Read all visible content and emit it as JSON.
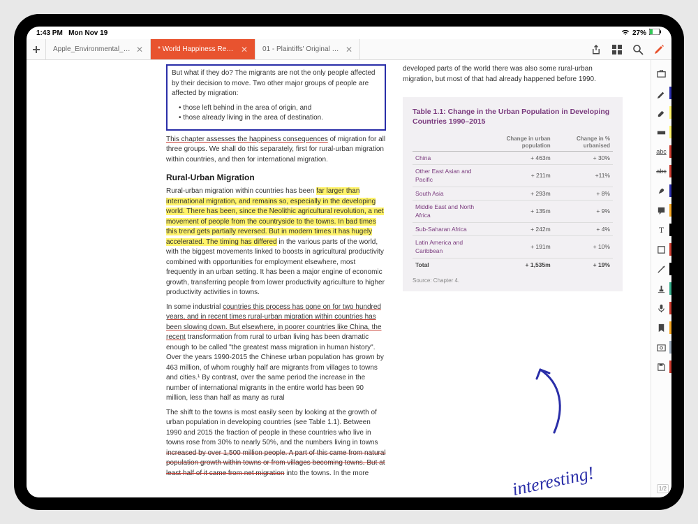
{
  "status": {
    "time": "1:43 PM",
    "date": "Mon Nov 19",
    "battery_pct": "27%"
  },
  "tabs": [
    {
      "label": "Apple_Environmental_R...",
      "active": false
    },
    {
      "label": "* World Happiness Repo...",
      "active": true
    },
    {
      "label": "01 - Plaintiffs' Original P...",
      "active": false
    }
  ],
  "doc": {
    "col1_boxed_p1": "But what if they do? The migrants are not the only people affected by their decision to move. Two other major groups of people are affected by migration:",
    "col1_boxed_b1": "those left behind in the area of origin, and",
    "col1_boxed_b2": "those already living in the area of destination.",
    "col1_p2_ul": "This chapter assesses the happiness consequences",
    "col1_p2_rest": " of migration for all three groups. We shall do this separately, first for rural-urban migration within countries, and then for international migration.",
    "col1_h": "Rural-Urban Migration",
    "col1_p3_a": "Rural-urban migration within countries has been ",
    "col1_p3_hl": "far larger than international migration, and remains so, especially in the developing world. There has been, since the Neolithic agricultural revolution, a net movement of people from the countryside to the towns. In bad times this trend gets partially reversed. But in modern times it has hugely accelerated. The timing has differed",
    "col1_p3_b": " in the various parts of the world, with the biggest movements linked to boosts in agricultural productivity combined with opportunities for employment elsewhere, most frequently in an urban setting. It has been a major engine of economic growth, transferring people from lower productivity agriculture to higher productivity activities in towns.",
    "col1_p4_a": "In some industrial ",
    "col1_p4_ul": "countries this process has gone on for two hundred years, and in recent times rural-urban migration within countries has been slowing down. But elsewhere, in poorer countries like China, the recent",
    "col1_p4_b": " transformation from rural to urban living has been dramatic enough to be called \"the greatest mass migration in human history\". Over the years 1990-2015 the Chinese urban population has grown by 463 million, of whom roughly half are migrants from villages to towns and cities.¹ By contrast, over the same period the increase in the number of international migrants in the entire world has been 90 million, less than half as many as rural",
    "col2_p1_a": "The shift to the towns is most easily seen by looking at the growth of urban population in developing countries (see Table 1.1). Between 1990 and 2015 the fraction of people in these countries who live in towns rose from 30% to nearly 50%, and the numbers living in towns ",
    "col2_p1_strike": "increased by over 1,500 million people. A part of this came from natural population growth within towns or from villages becoming towns. But at least half of it came from net migration",
    "col2_p1_b": " into the towns. In the more developed parts of the world there was also some rural-urban migration, but most of that had already happened before 1990.",
    "table_title": "Table 1.1: Change in the Urban Population in Developing Countries 1990–2015",
    "table_src": "Source: Chapter 4."
  },
  "chart_data": {
    "type": "table",
    "title": "Table 1.1: Change in the Urban Population in Developing Countries 1990–2015",
    "columns": [
      "",
      "Change in urban population",
      "Change in % urbanised"
    ],
    "rows": [
      {
        "region": "China",
        "pop": "+ 463m",
        "pct": "+ 30%"
      },
      {
        "region": "Other East Asian and Pacific",
        "pop": "+ 211m",
        "pct": "+11%"
      },
      {
        "region": "South Asia",
        "pop": "+ 293m",
        "pct": "+ 8%"
      },
      {
        "region": "Middle East and North Africa",
        "pop": "+ 135m",
        "pct": "+ 9%"
      },
      {
        "region": "Sub-Saharan Africa",
        "pop": "+ 242m",
        "pct": "+ 4%"
      },
      {
        "region": "Latin America and Caribbean",
        "pop": "+ 191m",
        "pct": "+ 10%"
      }
    ],
    "total": {
      "region": "Total",
      "pop": "+ 1,535m",
      "pct": "+ 19%"
    }
  },
  "annotation": {
    "text": "interesting!"
  },
  "tool_colors": {
    "pen": "#2a2ea8",
    "marker": "#fff36a",
    "highlighter": "#fff36a",
    "underline": "#c83a2e",
    "strike": "#c83a2e",
    "ink": "#2a2ea8",
    "note": "#f5a623",
    "line": "#000",
    "photo": "#8aa",
    "save": "#c83a2e"
  },
  "pagecount": "1/2"
}
